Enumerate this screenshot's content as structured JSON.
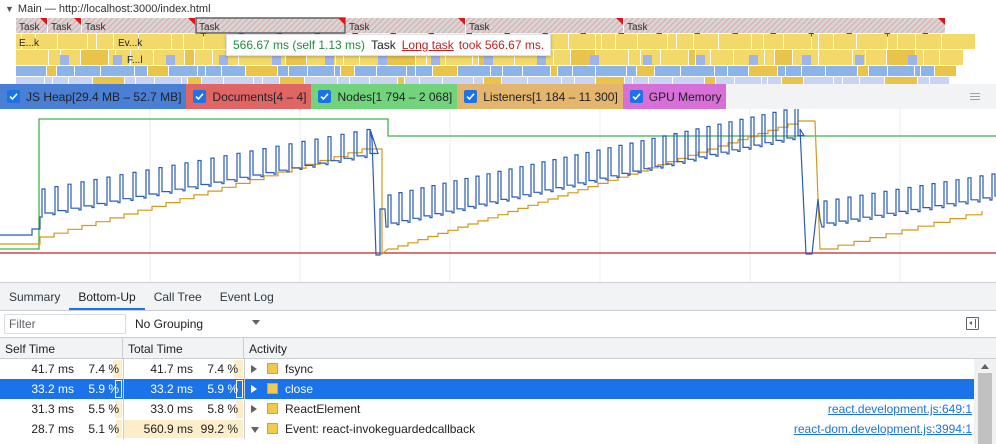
{
  "flame": {
    "header": "Main — http://localhost:3000/index.html",
    "task_label": "Task",
    "tasks": [
      {
        "label": "Task",
        "long": true
      },
      {
        "label": "Task",
        "long": true
      },
      {
        "label": "Task",
        "long": true
      },
      {
        "label": "Task",
        "long": true,
        "selected": true
      },
      {
        "label": "Task",
        "long": true
      },
      {
        "label": "Task",
        "long": true
      },
      {
        "label": "Task",
        "long": true
      }
    ],
    "sub_labels": [
      "E...k",
      "Ev...k",
      "F...l"
    ],
    "tooltip": {
      "duration": "566.67 ms (self 1.13 ms)",
      "name": "Task",
      "link": "Long task",
      "suffix": "took 566.67 ms."
    },
    "colors": {
      "task_gray": "#d6d6d6",
      "long_task_red": "#e01515",
      "scripting": "#f3d96a",
      "function": "#e8c44a",
      "layout_blue": "#8db4e8"
    }
  },
  "counters": [
    {
      "label": "JS Heap[29.4 MB – 52.7 MB]",
      "color": "#4a7fd6",
      "checked": true
    },
    {
      "label": "Documents[4 – 4]",
      "color": "#e06666",
      "checked": true
    },
    {
      "label": "Nodes[1 794 – 2 068]",
      "color": "#72d47a",
      "checked": true
    },
    {
      "label": "Listeners[1 184 – 11 300]",
      "color": "#e4b56c",
      "checked": true
    },
    {
      "label": "GPU Memory",
      "color": "#d86fd8",
      "checked": true
    }
  ],
  "graph_colors": {
    "js_heap": "#2a5bb5",
    "documents": "#c0252b",
    "nodes": "#3fb24a",
    "listeners": "#d29a1c"
  },
  "tabs": [
    {
      "label": "Summary",
      "active": false
    },
    {
      "label": "Bottom-Up",
      "active": true
    },
    {
      "label": "Call Tree",
      "active": false
    },
    {
      "label": "Event Log",
      "active": false
    }
  ],
  "toolbar": {
    "filter_placeholder": "Filter",
    "grouping": "No Grouping"
  },
  "table": {
    "headers": {
      "self_time": "Self Time",
      "total_time": "Total Time",
      "activity": "Activity"
    },
    "rows": [
      {
        "self_ms": "41.7 ms",
        "self_pct": "7.4 %",
        "self_frac": 0.074,
        "total_ms": "41.7 ms",
        "total_pct": "7.4 %",
        "total_frac": 0.074,
        "activity": "fsync",
        "source": "",
        "expanded": false,
        "selected": false
      },
      {
        "self_ms": "33.2 ms",
        "self_pct": "5.9 %",
        "self_frac": 0.059,
        "total_ms": "33.2 ms",
        "total_pct": "5.9 %",
        "total_frac": 0.059,
        "activity": "close",
        "source": "",
        "expanded": false,
        "selected": true
      },
      {
        "self_ms": "31.3 ms",
        "self_pct": "5.5 %",
        "self_frac": 0.055,
        "total_ms": "33.0 ms",
        "total_pct": "5.8 %",
        "total_frac": 0.058,
        "activity": "ReactElement",
        "source": "react.development.js:649:1",
        "expanded": false,
        "selected": false
      },
      {
        "self_ms": "28.7 ms",
        "self_pct": "5.1 %",
        "self_frac": 0.051,
        "total_ms": "560.9 ms",
        "total_pct": "99.2 %",
        "total_frac": 0.992,
        "activity": "Event: react-invokeguardedcallback",
        "source": "react-dom.development.js:3994:1",
        "expanded": true,
        "selected": false
      }
    ]
  }
}
